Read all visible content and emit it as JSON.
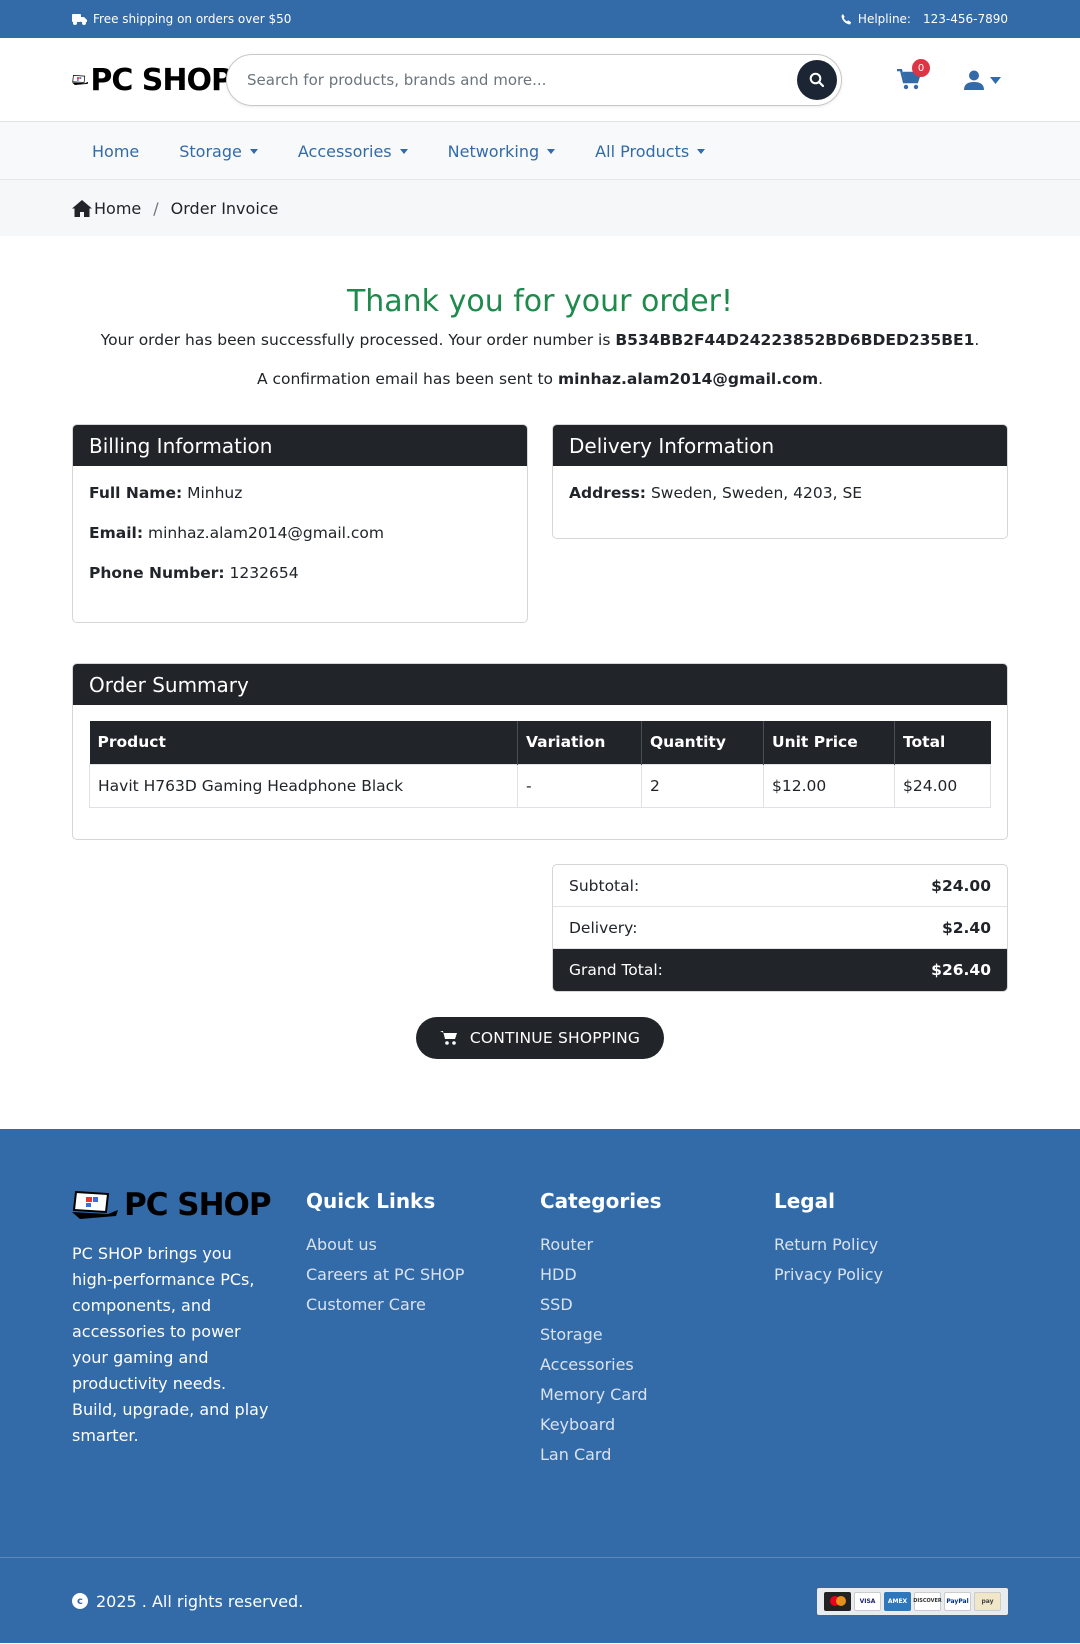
{
  "topbar": {
    "shipping": "Free shipping on orders over $50",
    "helpline_label": "Helpline:",
    "helpline_number": "123-456-7890"
  },
  "header": {
    "logo_text": "PC SHOP",
    "search_placeholder": "Search for products, brands and more...",
    "cart_count": "0"
  },
  "nav": {
    "items": [
      {
        "label": "Home",
        "dropdown": false
      },
      {
        "label": "Storage",
        "dropdown": true
      },
      {
        "label": "Accessories",
        "dropdown": true
      },
      {
        "label": "Networking",
        "dropdown": true
      },
      {
        "label": "All Products",
        "dropdown": true
      }
    ]
  },
  "breadcrumb": {
    "home": "Home",
    "separator": "/",
    "current": "Order Invoice"
  },
  "confirmation": {
    "heading": "Thank you for your order!",
    "order_prefix": "Your order has been successfully processed. Your order number is ",
    "order_number": "B534BB2F44D24223852BD6BDED235BE1",
    "order_suffix": ".",
    "email_prefix": "A confirmation email has been sent to ",
    "email": "minhaz.alam2014@gmail.com",
    "email_suffix": "."
  },
  "billing": {
    "title": "Billing Information",
    "name_label": "Full Name:",
    "name": "Minhuz",
    "email_label": "Email:",
    "email": "minhaz.alam2014@gmail.com",
    "phone_label": "Phone Number:",
    "phone": "1232654"
  },
  "delivery": {
    "title": "Delivery Information",
    "address_label": "Address:",
    "address": "Sweden, Sweden, 4203, SE"
  },
  "order_summary": {
    "title": "Order Summary",
    "columns": [
      "Product",
      "Variation",
      "Quantity",
      "Unit Price",
      "Total"
    ],
    "rows": [
      {
        "product": "Havit H763D Gaming Headphone Black",
        "variation": "-",
        "quantity": "2",
        "unit_price": "$12.00",
        "total": "$24.00"
      }
    ]
  },
  "totals": {
    "subtotal_label": "Subtotal:",
    "subtotal": "$24.00",
    "delivery_label": "Delivery:",
    "delivery": "$2.40",
    "grand_label": "Grand Total:",
    "grand": "$26.40"
  },
  "cta": {
    "label": "CONTINUE SHOPPING"
  },
  "footer": {
    "logo_text": "PC SHOP",
    "about": "PC SHOP brings you high-performance PCs, components, and accessories to power your gaming and productivity needs. Build, upgrade, and play smarter.",
    "quick_links": {
      "title": "Quick Links",
      "items": [
        "About us",
        "Careers at PC SHOP",
        "Customer Care"
      ]
    },
    "categories": {
      "title": "Categories",
      "items": [
        "Router",
        "HDD",
        "SSD",
        "Storage",
        "Accessories",
        "Memory Card",
        "Keyboard",
        "Lan Card"
      ]
    },
    "legal": {
      "title": "Legal",
      "items": [
        "Return Policy",
        "Privacy Policy"
      ]
    },
    "copyright": "2025 . All rights reserved.",
    "payment_icons": [
      "mastercard-icon",
      "visa-icon",
      "amex-icon",
      "discover-icon",
      "paypal-icon",
      "pay-icon"
    ]
  },
  "colors": {
    "brand_blue": "#336aa8",
    "dark": "#212529",
    "success_green": "#1e8a4c",
    "badge_red": "#dc3545"
  }
}
